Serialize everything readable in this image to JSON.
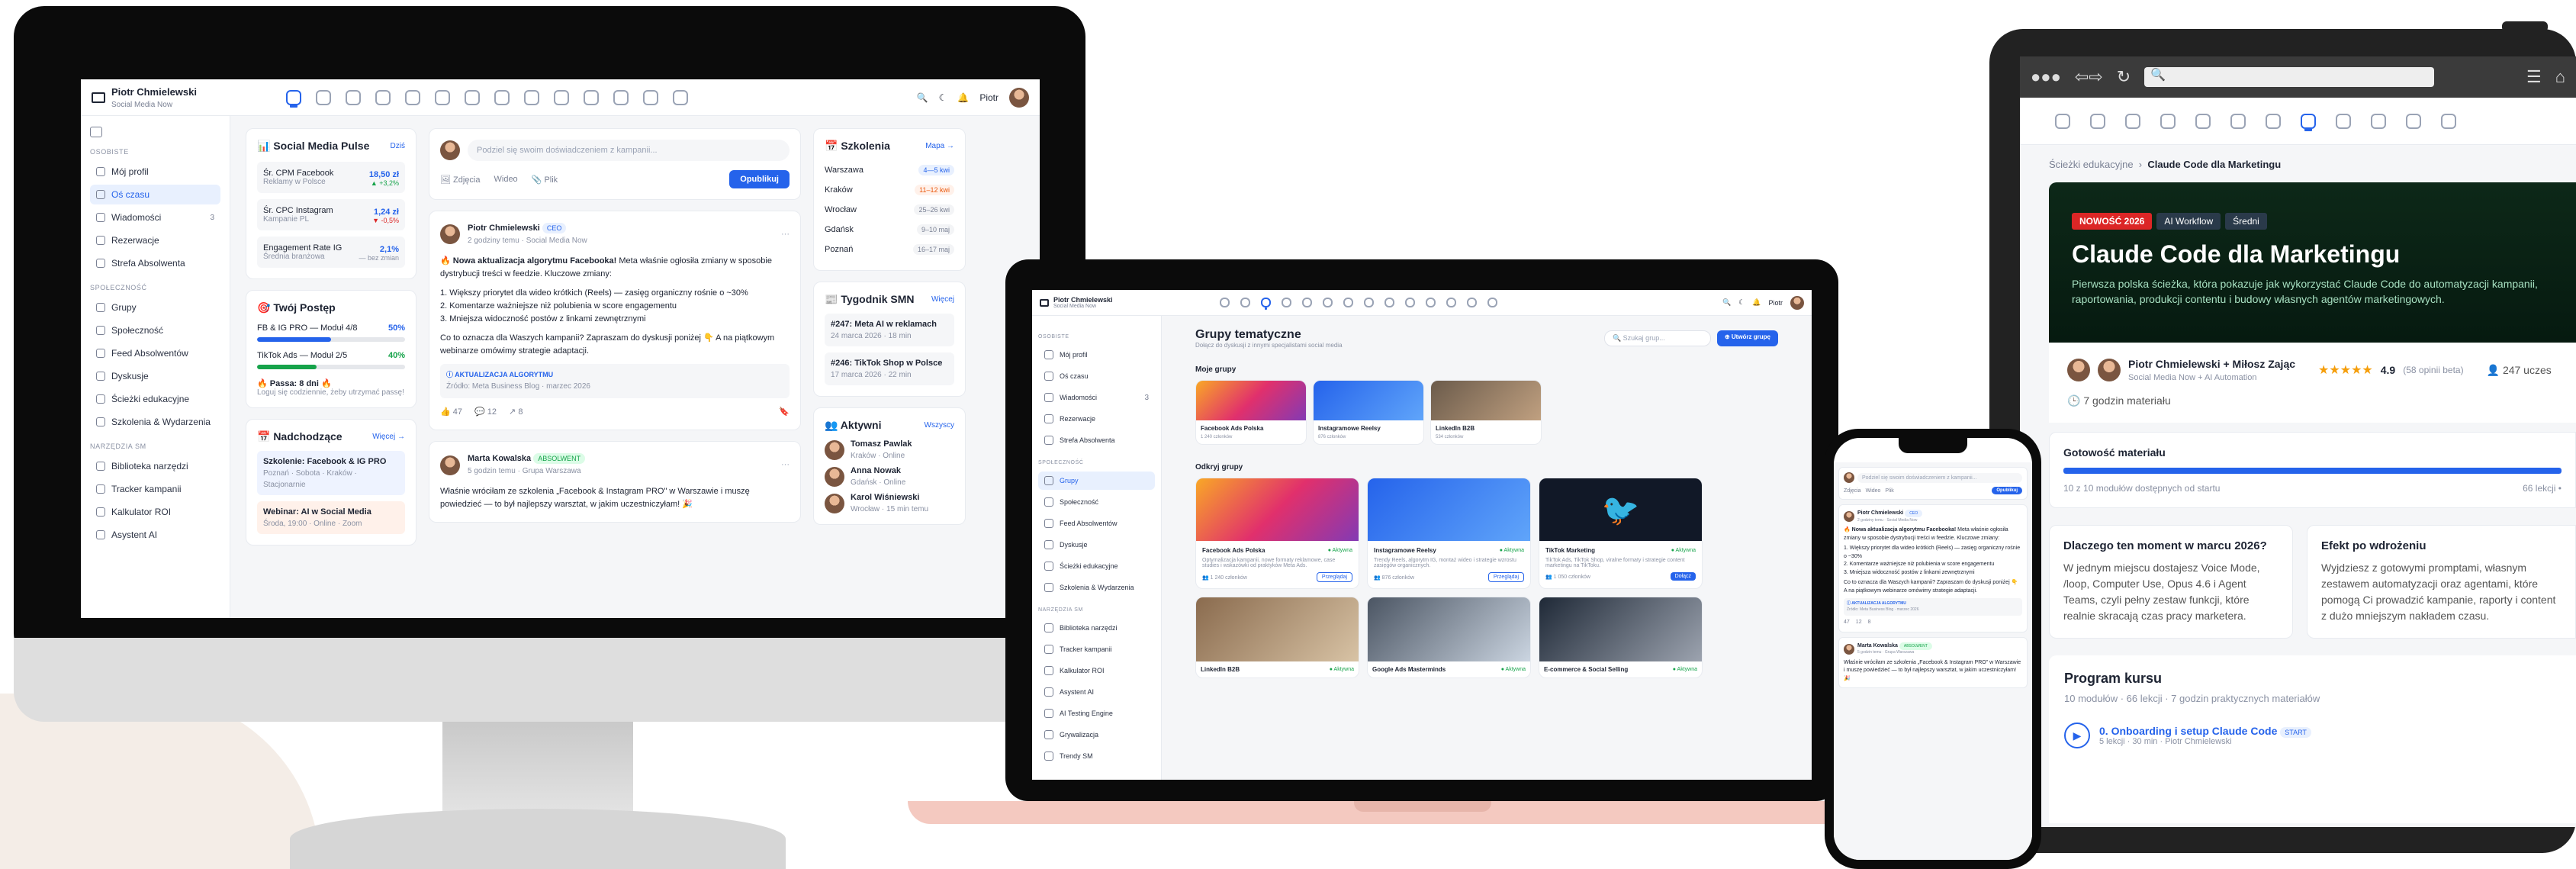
{
  "brand": {
    "name": "Piotr Chmielewski",
    "subtitle": "Social Media Now"
  },
  "user": {
    "name": "Piotr"
  },
  "sidebar": {
    "sec_personal": "OSOBISTE",
    "sec_community": "SPOŁECZNOŚĆ",
    "sec_tools": "NARZĘDZIA SM",
    "personal": [
      "Mój profil",
      "Oś czasu",
      "Wiadomości",
      "Rezerwacje",
      "Strefa Absolwenta"
    ],
    "messages_count": "3",
    "community": [
      "Grupy",
      "Społeczność",
      "Feed Absolwentów",
      "Dyskusje",
      "Ścieżki edukacyjne",
      "Szkolenia & Wydarzenia"
    ],
    "tools": [
      "Biblioteka narzędzi",
      "Tracker kampanii",
      "Kalkulator ROI",
      "Asystent AI"
    ],
    "tools_laptop": [
      "Biblioteka narzędzi",
      "Tracker kampanii",
      "Kalkulator ROI",
      "Asystent AI",
      "AI Testing Engine",
      "Grywalizacja",
      "Trendy SM"
    ]
  },
  "pulse": {
    "title": "📊 Social Media Pulse",
    "link": "Dziś",
    "items": [
      {
        "label": "Śr. CPM Facebook",
        "sub": "Reklamy w Polsce",
        "value": "18,50 zł",
        "delta": "▲ +3,2%"
      },
      {
        "label": "Śr. CPC Instagram",
        "sub": "Kampanie PL",
        "value": "1,24 zł",
        "delta": "▼ -0,5%"
      },
      {
        "label": "Engagement Rate IG",
        "sub": "Średnia branżowa",
        "value": "2,1%",
        "delta": "— bez zmian"
      }
    ]
  },
  "progress": {
    "title": "🎯 Twój Postęp",
    "items": [
      {
        "label": "FB & IG PRO — Moduł 4/8",
        "pct": "50%",
        "value": 0.5
      },
      {
        "label": "TikTok Ads — Moduł 2/5",
        "pct": "40%",
        "value": 0.4
      }
    ],
    "streak": "🔥 Passa: 8 dni 🔥",
    "streak_sub": "Loguj się codziennie, żeby utrzymać passę!"
  },
  "upcoming": {
    "title": "📅 Nadchodzące",
    "link": "Więcej →",
    "items": [
      {
        "title": "Szkolenie: Facebook & IG PRO",
        "sub": "Poznań · Sobota · Kraków · Stacjonarnie"
      },
      {
        "title": "Webinar: AI w Social Media",
        "sub": "Środa, 19:00 · Online · Zoom"
      }
    ]
  },
  "composer": {
    "placeholder": "Podziel się swoim doświadczeniem z kampanii...",
    "photos": "Zdjęcia",
    "video": "Wideo",
    "file": "Plik",
    "publish": "Opublikuj"
  },
  "post1": {
    "author": "Piotr Chmielewski",
    "badge": "CEO",
    "meta": "2 godziny temu · Social Media Now",
    "headline": "🔥 Nowa aktualizacja algorytmu Facebooka!",
    "intro": "Meta właśnie ogłosiła zmiany w sposobie dystrybucji treści w feedzie. Kluczowe zmiany:",
    "points": [
      "1. Większy priorytet dla wideo krótkich (Reels) — zasięg organiczny rośnie o ~30%",
      "2. Komentarze ważniejsze niż polubienia w score engagementu",
      "3. Mniejsza widoczność postów z linkami zewnętrznymi"
    ],
    "outro": "Co to oznacza dla Waszych kampanii? Zapraszam do dyskusji poniżej 👇 A na piątkowym webinarze omówimy strategie adaptacji.",
    "box_title": "ⓘ AKTUALIZACJA ALGORYTMU",
    "box_sub": "Źródło: Meta Business Blog · marzec 2026",
    "likes": "47",
    "comments": "12",
    "shares": "8"
  },
  "post2": {
    "author": "Marta Kowalska",
    "badge": "ABSOLWENT",
    "meta": "5 godzin temu · Grupa Warszawa",
    "text": "Właśnie wróciłam ze szkolenia „Facebook & Instagram PRO\" w Warszawie i muszę powiedzieć — to był najlepszy warsztat, w jakim uczestniczyłam! 🎉"
  },
  "trainings": {
    "title": "📅 Szkolenia",
    "link": "Mapa →",
    "items": [
      {
        "city": "Warszawa",
        "count": "4—5 kwi"
      },
      {
        "city": "Kraków",
        "count": "11–12 kwi"
      },
      {
        "city": "Wrocław",
        "count": "25–26 kwi"
      },
      {
        "city": "Gdańsk",
        "count": "9–10 maj"
      },
      {
        "city": "Poznań",
        "count": "16–17 maj"
      }
    ]
  },
  "weekly": {
    "title": "📰 Tygodnik SMN",
    "link": "Więcej",
    "items": [
      {
        "title": "#247: Meta AI w reklamach",
        "date": "24 marca 2026 · 18 min"
      },
      {
        "title": "#246: TikTok Shop w Polsce",
        "date": "17 marca 2026 · 22 min"
      }
    ]
  },
  "active": {
    "title": "👥 Aktywni",
    "link": "Wszyscy",
    "items": [
      {
        "name": "Tomasz Pawlak",
        "sub": "Kraków · Online"
      },
      {
        "name": "Anna Nowak",
        "sub": "Gdańsk · Online"
      },
      {
        "name": "Karol Wiśniewski",
        "sub": "Wrocław · 15 min temu"
      }
    ]
  },
  "groups": {
    "title": "Grupy tematyczne",
    "subtitle": "Dołącz do dyskusji z innymi specjalistami social media",
    "search": "Szukaj grup...",
    "create": "⊕ Utwórz grupę",
    "mine_title": "Moje grupy",
    "mine": [
      {
        "name": "Facebook Ads Polska",
        "members": "1 240 członków"
      },
      {
        "name": "Instagramowe Reelsy",
        "members": "876 członków"
      },
      {
        "name": "LinkedIn B2B",
        "members": "534 członków"
      }
    ],
    "discover_title": "Odkryj grupy",
    "discover": [
      {
        "name": "Facebook Ads Polska",
        "status": "● Aktywna",
        "desc": "Optymalizacja kampanii, nowe formaty reklamowe, case studies i wskazówki od praktyków Meta Ads.",
        "members": "👥 1 240 członków",
        "action": "Przeglądaj"
      },
      {
        "name": "Instagramowe Reelsy",
        "status": "● Aktywna",
        "desc": "Trendy Reels, algorytm IG, montaż wideo i strategie wzrostu zasięgów organicznych.",
        "members": "👥 876 członków",
        "action": "Przeglądaj"
      },
      {
        "name": "TikTok Marketing",
        "status": "● Aktywna",
        "desc": "TikTok Ads, TikTok Shop, viralne formaty i strategie content marketingu na TikToku.",
        "members": "👥 1 050 członków",
        "action": "Dołącz"
      }
    ],
    "discover2": [
      {
        "name": "LinkedIn B2B",
        "status": "● Aktywna"
      },
      {
        "name": "Google Ads Masterminds",
        "status": "● Aktywna"
      },
      {
        "name": "E-commerce & Social Selling",
        "status": "● Aktywna"
      }
    ]
  },
  "course": {
    "breadcrumb_root": "Ścieżki edukacyjne",
    "breadcrumb_current": "Claude Code dla Marketingu",
    "tag_new": "NOWOŚĆ 2026",
    "tag_a": "AI Workflow",
    "tag_b": "Średni",
    "title": "Claude Code dla Marketingu",
    "desc": "Pierwsza polska ścieżka, która pokazuje jak wykorzystać Claude Code do automatyzacji kampanii, raportowania, produkcji contentu i budowy własnych agentów marketingowych.",
    "authors": "Piotr Chmielewski + Miłosz Zając",
    "authors_sub": "Social Media Now + AI Automation",
    "rating": "4.9",
    "reviews": "(58 opinii beta)",
    "students": "247 uczes",
    "duration": "7 godzin materiału",
    "ready_title": "Gotowość materiału",
    "ready_sub": "10 z 10 modułów dostępnych od startu",
    "ready_count": "66 lekcji •",
    "ready_value": 1.0,
    "why_title": "Dlaczego ten moment w marcu 2026?",
    "why_text": "W jednym miejscu dostajesz Voice Mode, /loop, Computer Use, Opus 4.6 i Agent Teams, czyli pełny zestaw funkcji, które realnie skracają czas pracy marketera.",
    "effect_title": "Efekt po wdrożeniu",
    "effect_text": "Wyjdziesz z gotowymi promptami, własnym zestawem automatyzacji oraz agentami, które pomogą Ci prowadzić kampanie, raporty i content z dużo mniejszym nakładem czasu.",
    "program_title": "Program kursu",
    "program_sub": "10 modułów · 66 lekcji · 7 godzin praktycznych materiałów",
    "module": "0. Onboarding i setup Claude Code",
    "module_tag": "START",
    "module_sub": "5 lekcji · 30 min · Piotr Chmielewski"
  },
  "colors": {
    "accent": "#2563eb",
    "red": "#dc2626",
    "green": "#16a34a",
    "frame": "#0b0b0b"
  }
}
